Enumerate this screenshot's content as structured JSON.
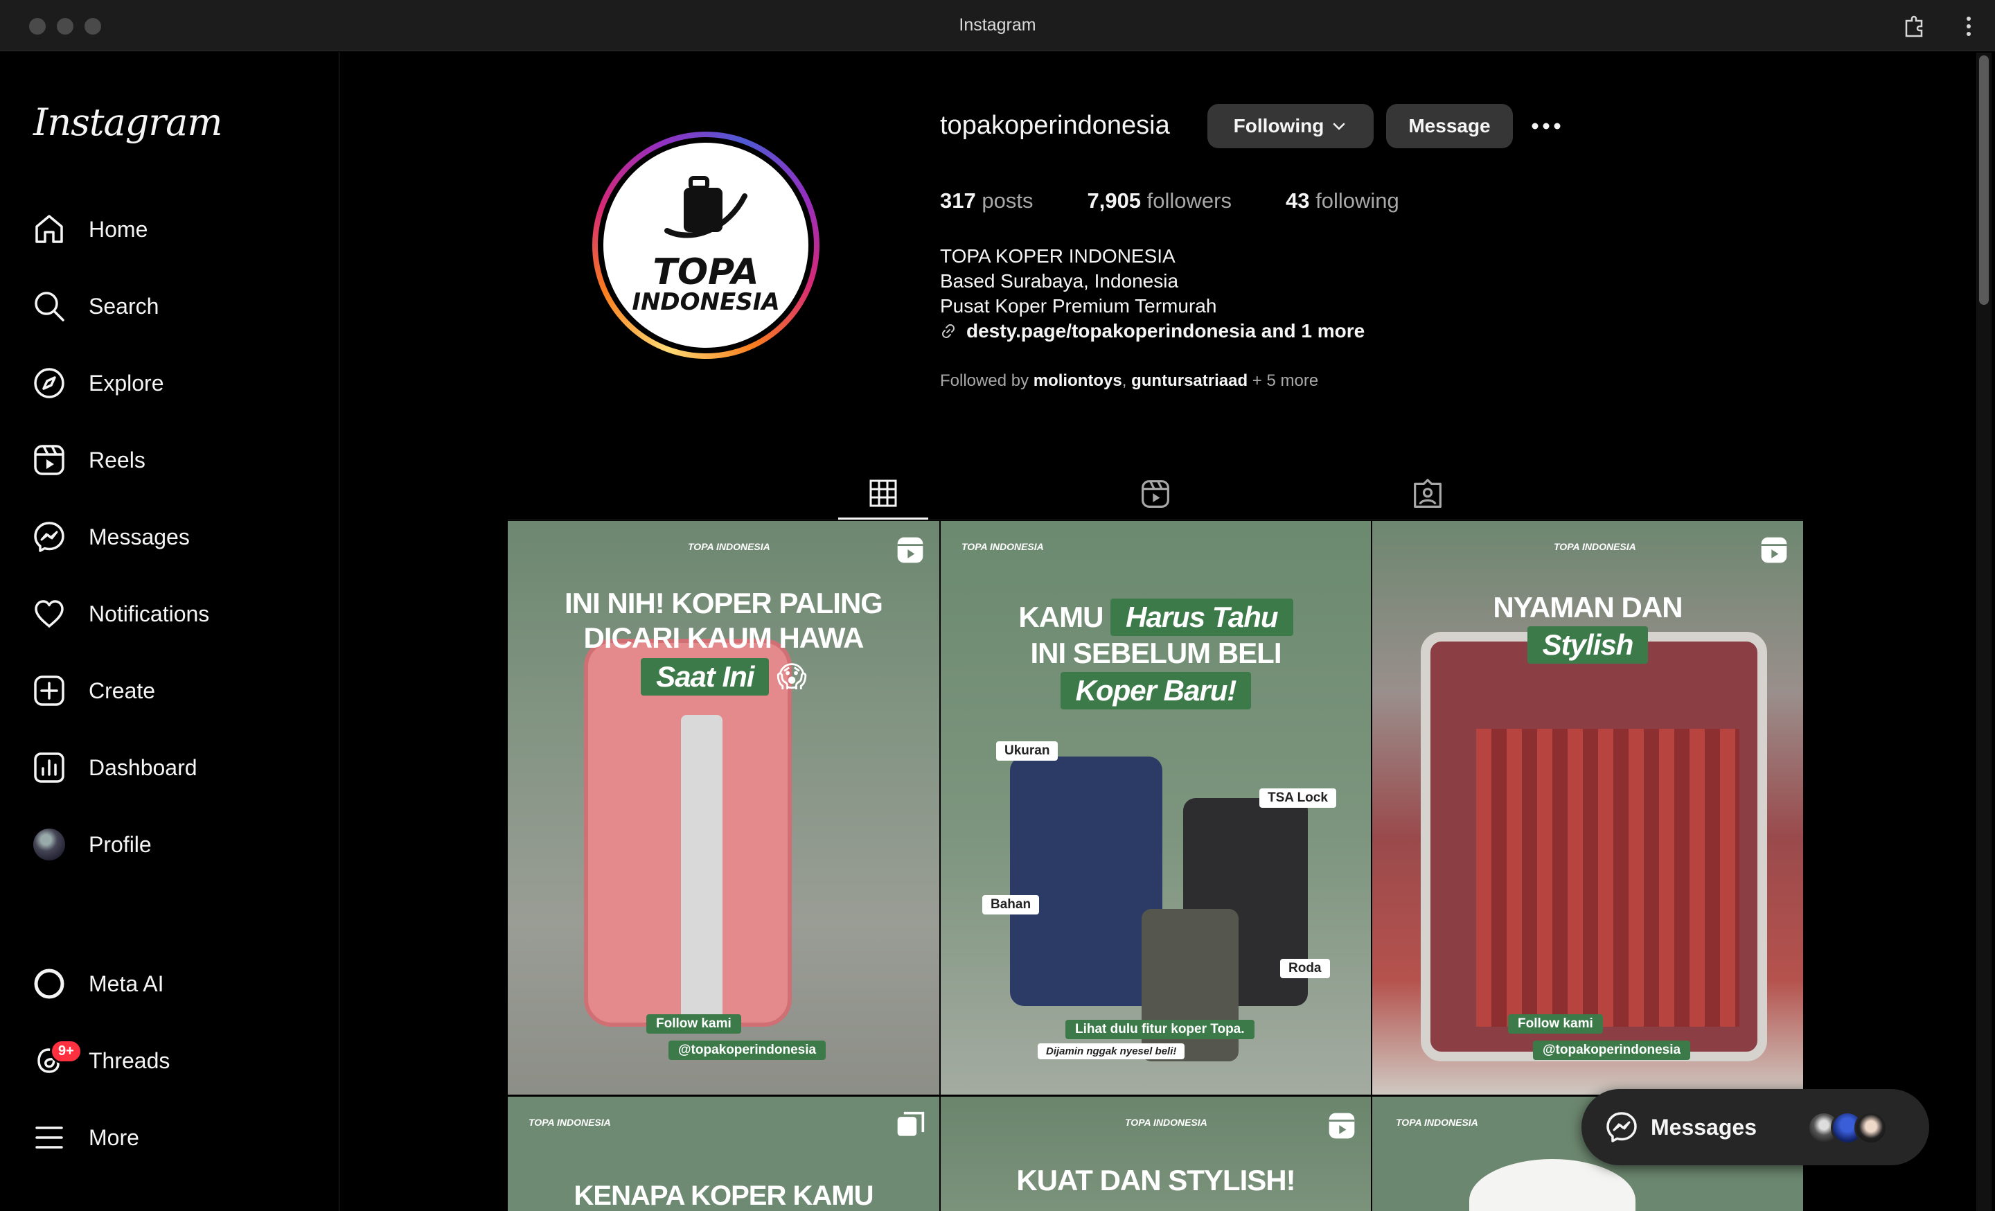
{
  "window": {
    "title": "Instagram"
  },
  "sidebar": {
    "logo": "Instagram",
    "items": [
      {
        "label": "Home",
        "icon": "home-icon"
      },
      {
        "label": "Search",
        "icon": "search-icon"
      },
      {
        "label": "Explore",
        "icon": "explore-icon"
      },
      {
        "label": "Reels",
        "icon": "reels-icon"
      },
      {
        "label": "Messages",
        "icon": "messenger-icon"
      },
      {
        "label": "Notifications",
        "icon": "heart-icon"
      },
      {
        "label": "Create",
        "icon": "plus-icon"
      },
      {
        "label": "Dashboard",
        "icon": "dashboard-icon"
      },
      {
        "label": "Profile",
        "icon": "avatar"
      },
      {
        "label": "Meta AI",
        "icon": "meta-ai-icon"
      },
      {
        "label": "Threads",
        "icon": "threads-icon",
        "badge": "9+"
      },
      {
        "label": "More",
        "icon": "menu-icon"
      }
    ]
  },
  "profile": {
    "username": "topakoperindonesia",
    "avatar_text_1": "TOPA",
    "avatar_text_2": "INDONESIA",
    "following_button": "Following",
    "message_button": "Message",
    "stats": {
      "posts_count": "317",
      "posts_label": "posts",
      "followers_count": "7,905",
      "followers_label": "followers",
      "following_count": "43",
      "following_label": "following"
    },
    "bio": {
      "name": "TOPA KOPER INDONESIA",
      "line1": "Based Surabaya, Indonesia",
      "line2": "Pusat Koper Premium Termurah",
      "link": "desty.page/topakoperindonesia and 1 more"
    },
    "followed_by": {
      "prefix": "Followed by",
      "user1": "moliontoys",
      "sep": ",",
      "user2": "guntursatriaad",
      "suffix": "+ 5 more"
    }
  },
  "tabs": [
    {
      "name": "posts",
      "icon": "grid-icon",
      "active": true
    },
    {
      "name": "reels",
      "icon": "reels-icon",
      "active": false
    },
    {
      "name": "tagged",
      "icon": "tagged-icon",
      "active": false
    }
  ],
  "posts": [
    {
      "brand": "TOPA INDONESIA",
      "headline_1": "INI NIH! KOPER PALING",
      "headline_2": "DICARI KAUM HAWA",
      "pill": "Saat Ini",
      "emoji": "😱",
      "tag_1": "Follow kami",
      "tag_2": "@topakoperindonesia",
      "type": "reel"
    },
    {
      "brand": "TOPA INDONESIA",
      "headline_1": "KAMU",
      "pill_1": "Harus Tahu",
      "headline_2": "INI SEBELUM BELI",
      "pill_2": "Koper Baru!",
      "labels": [
        "Ukuran",
        "TSA Lock",
        "Bahan",
        "Roda"
      ],
      "caption": "Lihat dulu fitur koper Topa.",
      "subcaption": "Dijamin nggak nyesel beli!"
    },
    {
      "brand": "TOPA INDONESIA",
      "headline_1": "NYAMAN DAN",
      "pill": "Stylish",
      "tag_1": "Follow kami",
      "tag_2": "@topakoperindonesia",
      "type": "reel"
    },
    {
      "brand": "TOPA INDONESIA",
      "headline_1": "KENAPA KOPER KAMU",
      "type": "carousel"
    },
    {
      "brand": "TOPA INDONESIA",
      "headline_1": "KUAT DAN STYLISH!",
      "type": "reel"
    },
    {
      "brand": "TOPA INDONESIA"
    }
  ],
  "messages_pill": {
    "label": "Messages"
  },
  "colors": {
    "accent_green": "#3d7a4a",
    "badge_red": "#ff3040",
    "button_bg": "#363636"
  }
}
